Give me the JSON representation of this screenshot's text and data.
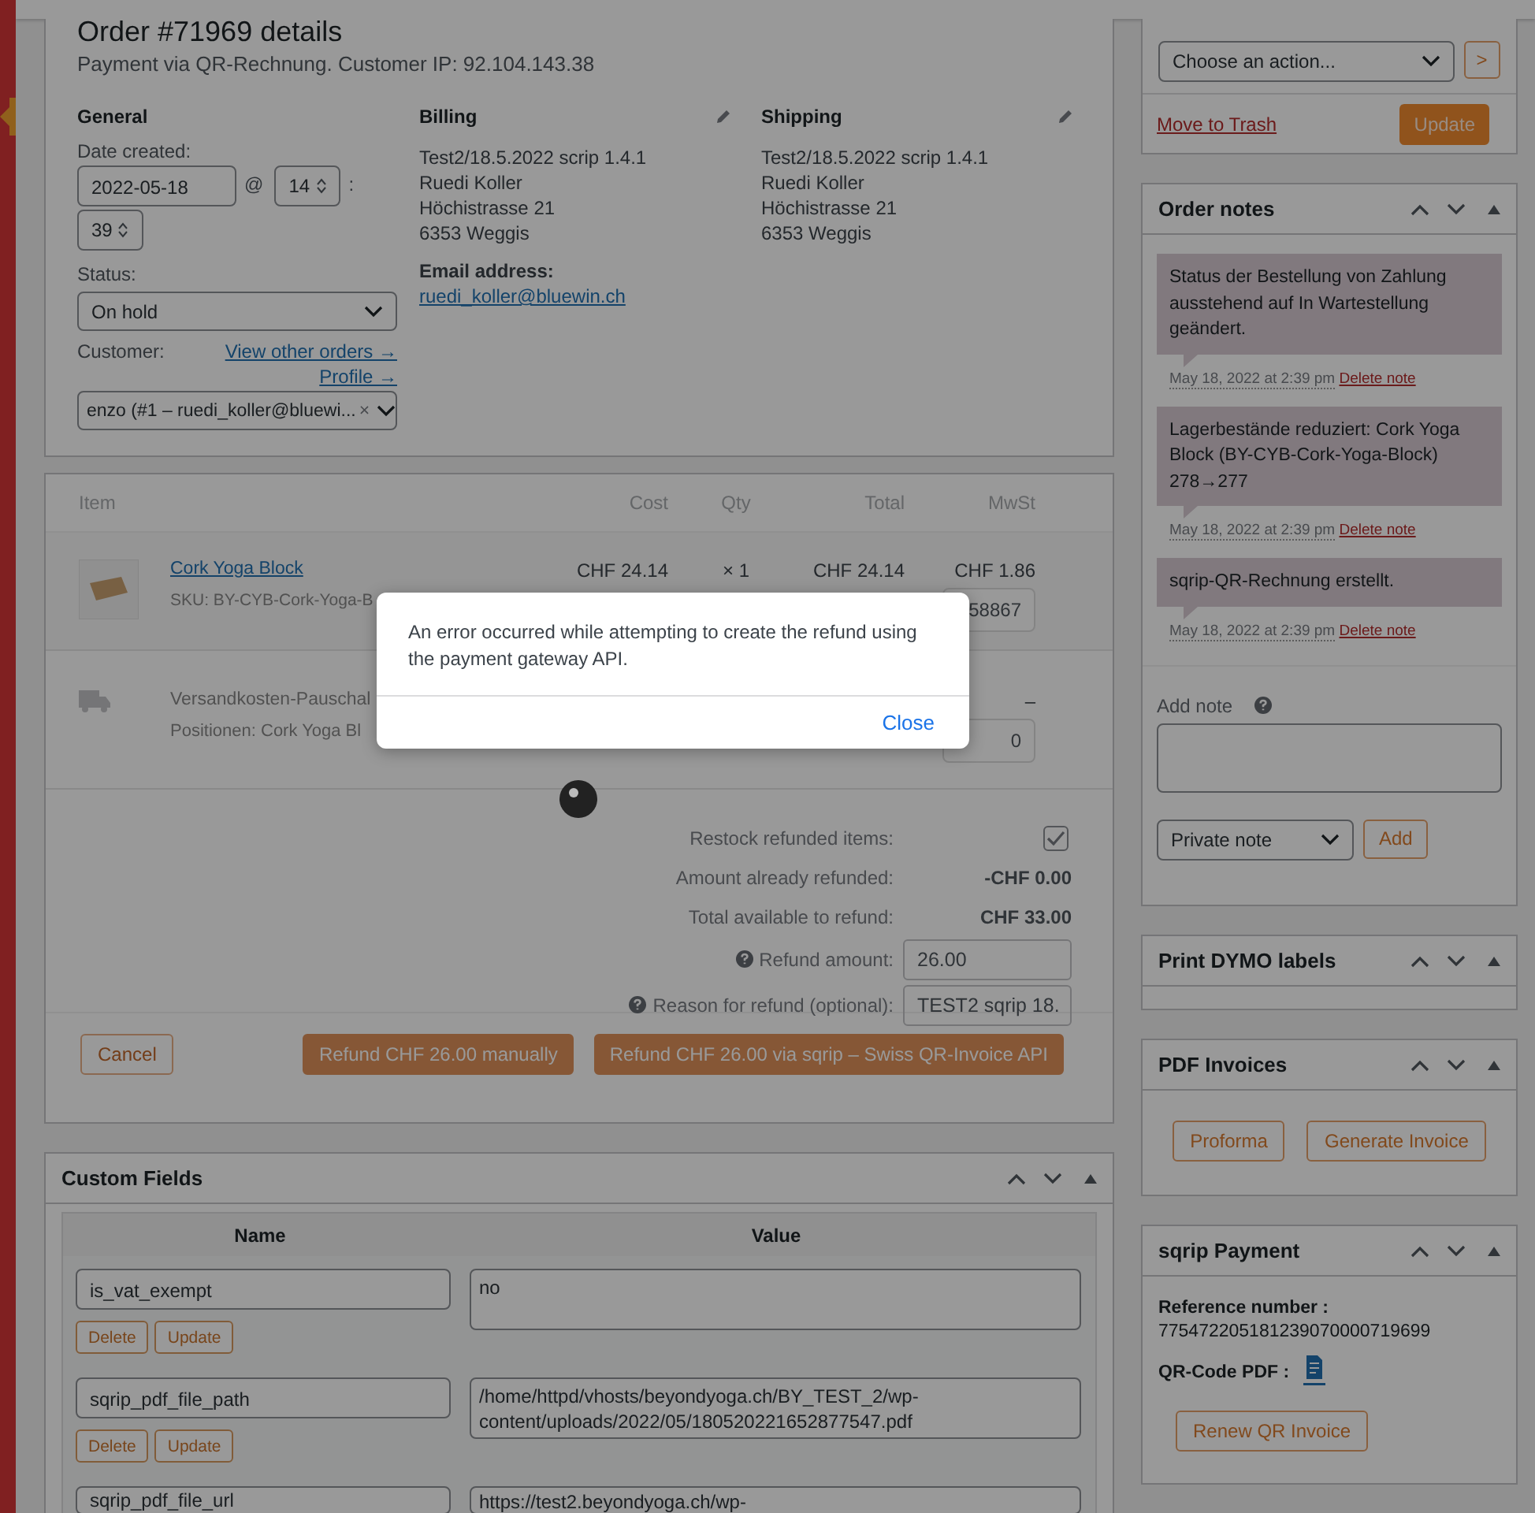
{
  "order": {
    "title": "Order #71969 details",
    "subtitle": "Payment via QR-Rechnung. Customer IP: 92.104.143.38",
    "general": {
      "heading": "General",
      "date_label": "Date created:",
      "date": "2022-05-18",
      "at": "@",
      "hour": "14",
      "colon": ":",
      "minute": "39",
      "status_label": "Status:",
      "status": "On hold",
      "customer_label": "Customer:",
      "view_orders": "View other orders →",
      "profile": "Profile →",
      "customer": "enzo (#1 – ruedi_koller@bluewi...",
      "clear": "×"
    },
    "billing": {
      "heading": "Billing",
      "lines": [
        "Test2/18.5.2022 scrip 1.4.1",
        "Ruedi Koller",
        "Höchistrasse 21",
        "6353 Weggis"
      ],
      "email_label": "Email address:",
      "email": "ruedi_koller@bluewin.ch"
    },
    "shipping": {
      "heading": "Shipping",
      "lines": [
        "Test2/18.5.2022 scrip 1.4.1",
        "Ruedi Koller",
        "Höchistrasse 21",
        "6353 Weggis"
      ]
    }
  },
  "items": {
    "columns": [
      "Item",
      "Cost",
      "Qty",
      "Total",
      "MwSt"
    ],
    "rows": [
      {
        "kind": "product",
        "name": "Cork Yoga Block",
        "meta_label": "SKU:",
        "meta": "BY-CYB-Cork-Yoga-B",
        "cost": "CHF 24.14",
        "qty": "× 1",
        "total": "CHF 24.14",
        "tax": "CHF 1.86",
        "tax_input": "58867"
      },
      {
        "kind": "shipping",
        "name": "Versandkosten-Pauschal",
        "meta_label": "Positionen:",
        "meta": "Cork Yoga Bl",
        "tax": "–",
        "tax_input": "0"
      }
    ],
    "refund": {
      "restock_label": "Restock refunded items:",
      "restock_checked": true,
      "already_label": "Amount already refunded:",
      "already": "-CHF 0.00",
      "available_label": "Total available to refund:",
      "available": "CHF 33.00",
      "amount_label": "Refund amount:",
      "amount": "26.00",
      "reason_label": "Reason for refund (optional):",
      "reason": "TEST2 sqrip 18."
    },
    "cancel": "Cancel",
    "refund_manual": "Refund CHF 26.00 manually",
    "refund_api": "Refund CHF 26.00 via sqrip – Swiss QR-Invoice API"
  },
  "modal": {
    "message": "An error occurred while attempting to create the refund using the payment gateway API.",
    "close": "Close"
  },
  "custom_fields": {
    "title": "Custom Fields",
    "columns": [
      "Name",
      "Value"
    ],
    "rows": [
      {
        "name": "is_vat_exempt",
        "value": "no",
        "buttons": [
          "Delete",
          "Update"
        ]
      },
      {
        "name": "sqrip_pdf_file_path",
        "value": "/home/httpd/vhosts/beyondyoga.ch/BY_TEST_2/wp-content/uploads/2022/05/180520221652877547.pdf",
        "buttons": [
          "Delete",
          "Update"
        ]
      },
      {
        "name": "sqrip_pdf_file_url",
        "value": "https://test2.beyondyoga.ch/wp-",
        "buttons": []
      }
    ]
  },
  "actions": {
    "select": "Choose an action...",
    "go": ">",
    "trash": "Move to Trash",
    "update": "Update"
  },
  "notes": {
    "title": "Order notes",
    "items": [
      {
        "text": "Status der Bestellung von Zahlung ausstehend auf In Wartestellung geändert.",
        "date": "May 18, 2022 at 2:39 pm",
        "delete": "Delete note"
      },
      {
        "text": "Lagerbestände reduziert: Cork Yoga Block (BY-CYB-Cork-Yoga-Block) 278→277",
        "date": "May 18, 2022 at 2:39 pm",
        "delete": "Delete note"
      },
      {
        "text": "sqrip-QR-Rechnung erstellt.",
        "date": "May 18, 2022 at 2:39 pm",
        "delete": "Delete note"
      }
    ],
    "add_label": "Add note",
    "note_type": "Private note",
    "add": "Add"
  },
  "dymo": {
    "title": "Print DYMO labels"
  },
  "pdf": {
    "title": "PDF Invoices",
    "buttons": [
      "Proforma",
      "Generate Invoice"
    ]
  },
  "sqrip": {
    "title": "sqrip Payment",
    "ref_label": "Reference number :",
    "ref": "775472205181239070000719699",
    "qr_label": "QR-Code PDF :",
    "renew": "Renew QR Invoice"
  }
}
